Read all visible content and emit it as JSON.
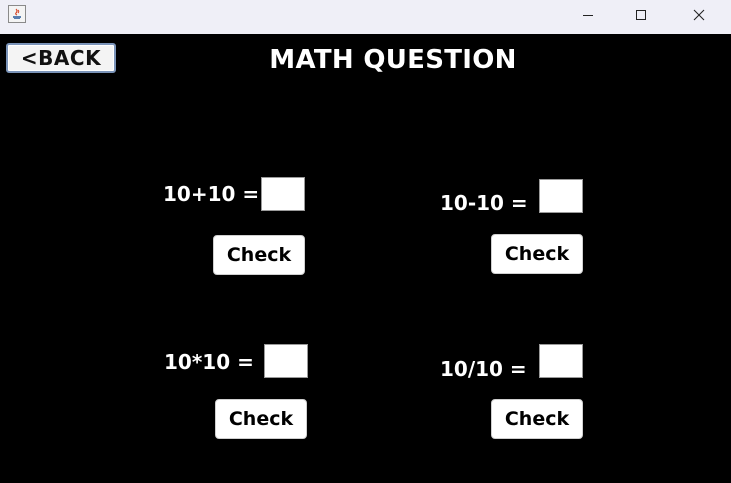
{
  "window": {
    "title": "",
    "controls": {
      "minimize": "minimize-icon",
      "maximize": "maximize-icon",
      "close": "close-icon"
    }
  },
  "header": {
    "back_label": "<BACK",
    "title": "MATH QUESTION"
  },
  "questions": [
    {
      "prompt": "10+10 =",
      "answer": "",
      "check_label": "Check"
    },
    {
      "prompt": "10-10 =",
      "answer": "",
      "check_label": "Check"
    },
    {
      "prompt": "10*10 =",
      "answer": "",
      "check_label": "Check"
    },
    {
      "prompt": "10/10 =",
      "answer": "",
      "check_label": "Check"
    }
  ],
  "colors": {
    "background": "#000000",
    "titlebar": "#efeff7",
    "text": "#ffffff",
    "button_text": "#000000"
  }
}
